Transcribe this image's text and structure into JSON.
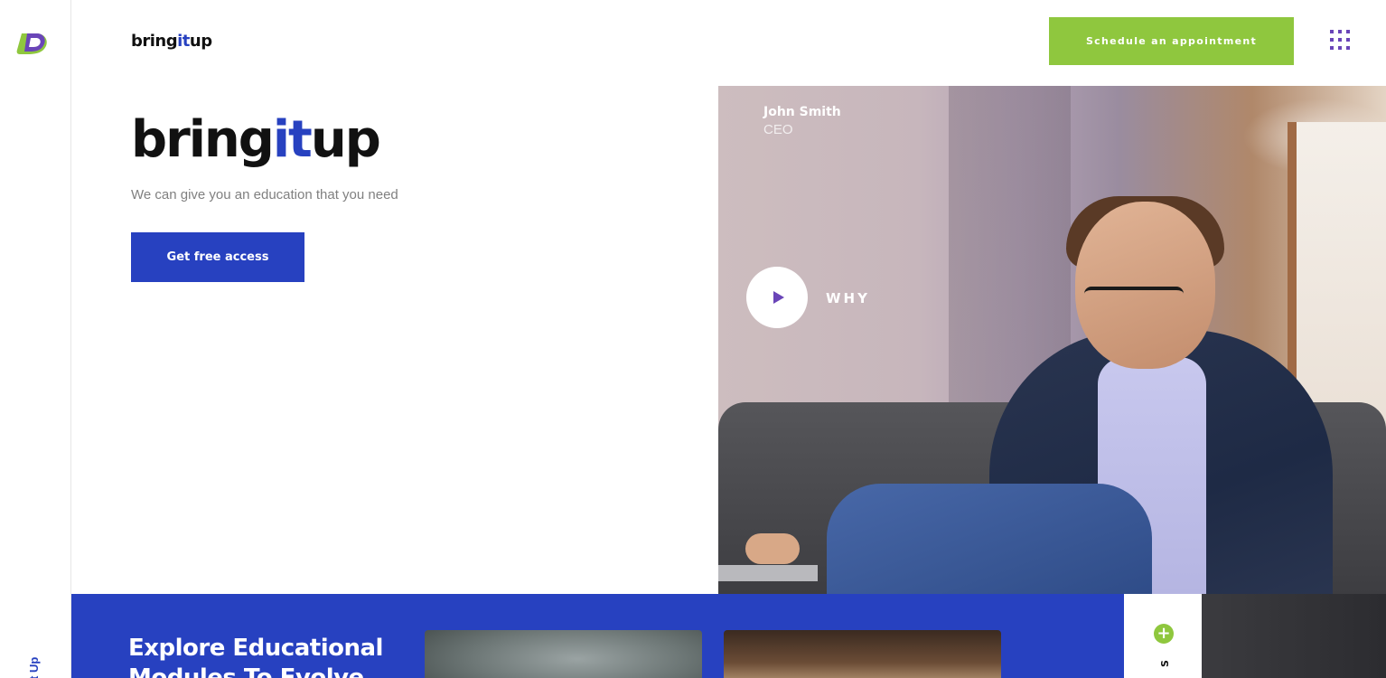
{
  "rail": {
    "logo_icon": "brand-mark-icon",
    "vertical_text": "t Up"
  },
  "header": {
    "brand_prefix": "bring",
    "brand_accent": "it",
    "brand_suffix": "up",
    "cta_label": "Schedule an appointment",
    "menu_icon": "grid-dots-icon"
  },
  "hero": {
    "title_prefix": "bring",
    "title_accent": "it",
    "title_suffix": "up",
    "subtitle": "We can give you an education that you need",
    "button_label": "Get free access"
  },
  "feature": {
    "person_name": "John Smith",
    "person_role": "CEO",
    "play_icon": "play-icon",
    "play_label": "WHY"
  },
  "band": {
    "title": "Explore Educational Modules To Evolve",
    "plus_icon": "plus-circle-icon",
    "side_letter": "S"
  },
  "colors": {
    "accent_blue": "#2741c0",
    "accent_green": "#8fc73e",
    "accent_purple": "#6a45b8",
    "muted_text": "#808080"
  }
}
